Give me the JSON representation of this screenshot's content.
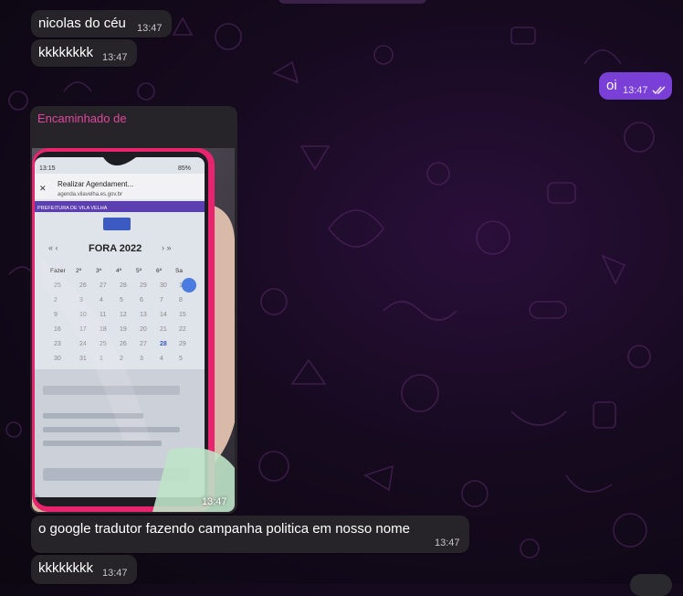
{
  "messages": [
    {
      "sender": "nicolas do céu",
      "time": "13:47"
    },
    {
      "text": "kkkkkkkk",
      "time": "13:47"
    },
    {
      "text": "oi",
      "time": "13:47"
    },
    {
      "forward_label": "Encaminhado de",
      "time": "13:47"
    },
    {
      "text": "o google tradutor fazendo campanha politica em nosso nome",
      "time": "13:47"
    },
    {
      "text": "kkkkkkkk",
      "time": "13:47"
    }
  ],
  "forwarded_photo": {
    "title": "Realizar Agendament...",
    "url": "agenda.vilavelha.es.gov.br",
    "header": "PREFEITURA DE VILA VELHA",
    "month_label": "FORA 2022",
    "weekdays": [
      "Fazer",
      "2ª",
      "3ª",
      "4ª",
      "5ª",
      "6ª",
      "Sa"
    ],
    "days": [
      "25",
      "26",
      "27",
      "28",
      "29",
      "30",
      "1",
      "2",
      "3",
      "4",
      "5",
      "6",
      "7",
      "8",
      "9",
      "10",
      "11",
      "12",
      "13",
      "14",
      "15",
      "16",
      "17",
      "18",
      "19",
      "20",
      "21",
      "22",
      "23",
      "24",
      "25",
      "26",
      "27",
      "28",
      "29",
      "30",
      "31",
      "1",
      "2",
      "3",
      "4",
      "5"
    ],
    "status_time": "13:15",
    "battery": "85%"
  },
  "colors": {
    "outgoing_bubble": "#7a3fd6",
    "incoming_bubble": "#262428",
    "forward_label": "#e0479f",
    "phone_case": "#e8246f"
  }
}
